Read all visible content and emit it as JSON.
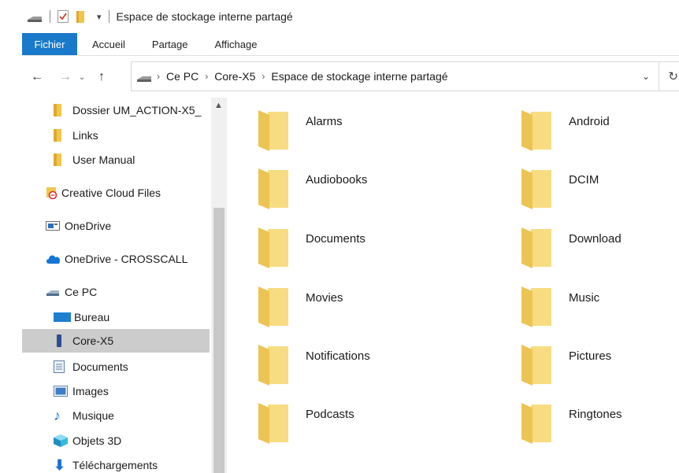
{
  "window": {
    "title": "Espace de stockage interne partagé"
  },
  "ribbon": {
    "tabs": [
      "Fichier",
      "Accueil",
      "Partage",
      "Affichage"
    ]
  },
  "address": {
    "crumbs": [
      "Ce PC",
      "Core-X5",
      "Espace de stockage interne partagé"
    ]
  },
  "nav": {
    "items": [
      {
        "label": "Dossier UM_ACTION-X5_",
        "icon": "folder-icon"
      },
      {
        "label": "Links",
        "icon": "folder-icon"
      },
      {
        "label": "User Manual",
        "icon": "folder-icon"
      },
      {
        "label": "Creative Cloud Files",
        "icon": "creative-cloud-icon"
      },
      {
        "label": "OneDrive",
        "icon": "onedrive-icon"
      },
      {
        "label": "OneDrive - CROSSCALL",
        "icon": "cloud-icon"
      },
      {
        "label": "Ce PC",
        "icon": "computer-icon"
      },
      {
        "label": "Bureau",
        "icon": "desktop-icon"
      },
      {
        "label": "Core-X5",
        "icon": "phone-icon",
        "selected": true
      },
      {
        "label": "Documents",
        "icon": "documents-icon"
      },
      {
        "label": "Images",
        "icon": "images-icon"
      },
      {
        "label": "Musique",
        "icon": "music-icon"
      },
      {
        "label": "Objets 3D",
        "icon": "objects-3d-icon"
      },
      {
        "label": "Téléchargements",
        "icon": "downloads-icon"
      }
    ]
  },
  "folders": [
    "Alarms",
    "Android",
    "Audiobooks",
    "DCIM",
    "Documents",
    "Download",
    "Movies",
    "Music",
    "Notifications",
    "Pictures",
    "Podcasts",
    "Ringtones"
  ],
  "colors": {
    "accent": "#1979ca",
    "folder": "#f7d675",
    "selection": "#cccccc"
  }
}
